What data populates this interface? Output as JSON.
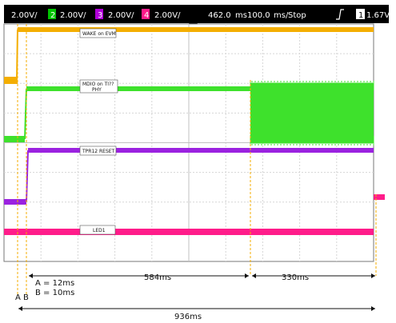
{
  "header": {
    "ch1_scale": "2.00V/",
    "ch2_num": "2",
    "ch2_scale": "2.00V/",
    "ch3_num": "3",
    "ch3_scale": "2.00V/",
    "ch4_num": "4",
    "ch4_scale": "2.00V/",
    "timebase_pos": "462.0",
    "timebase_scale": "100.0",
    "run_state": "Stop",
    "trigger_icon": "rising-edge-trigger-icon",
    "trigger_channel": "1",
    "trigger_level": "1.67V"
  },
  "labels": {
    "ch1": "WAKE on EVM",
    "ch2_line1": "MDIO on TI??",
    "ch2_line2": "PHY",
    "ch3": "TPR12 RESET",
    "ch4": "LED1"
  },
  "annotations": {
    "a_value": "A = 12ms",
    "b_value": "B = 10ms",
    "marker_a": "A",
    "marker_b": "B",
    "interval_584": "584ms",
    "interval_330": "330ms",
    "total": "936ms"
  },
  "colors": {
    "screen_bg": "#ffffff",
    "header_bg": "#000000",
    "grid": "#d8d8d8",
    "ch1": "#f4ae00",
    "ch2": "#3ee12c",
    "ch3": "#9b22e0",
    "ch4": "#ff1c8a",
    "cursor_line": "#f4ae00",
    "header_ch2_box": "#00c400",
    "header_ch3_box": "#b000d8",
    "header_ch4_box": "#ff1c8a"
  }
}
